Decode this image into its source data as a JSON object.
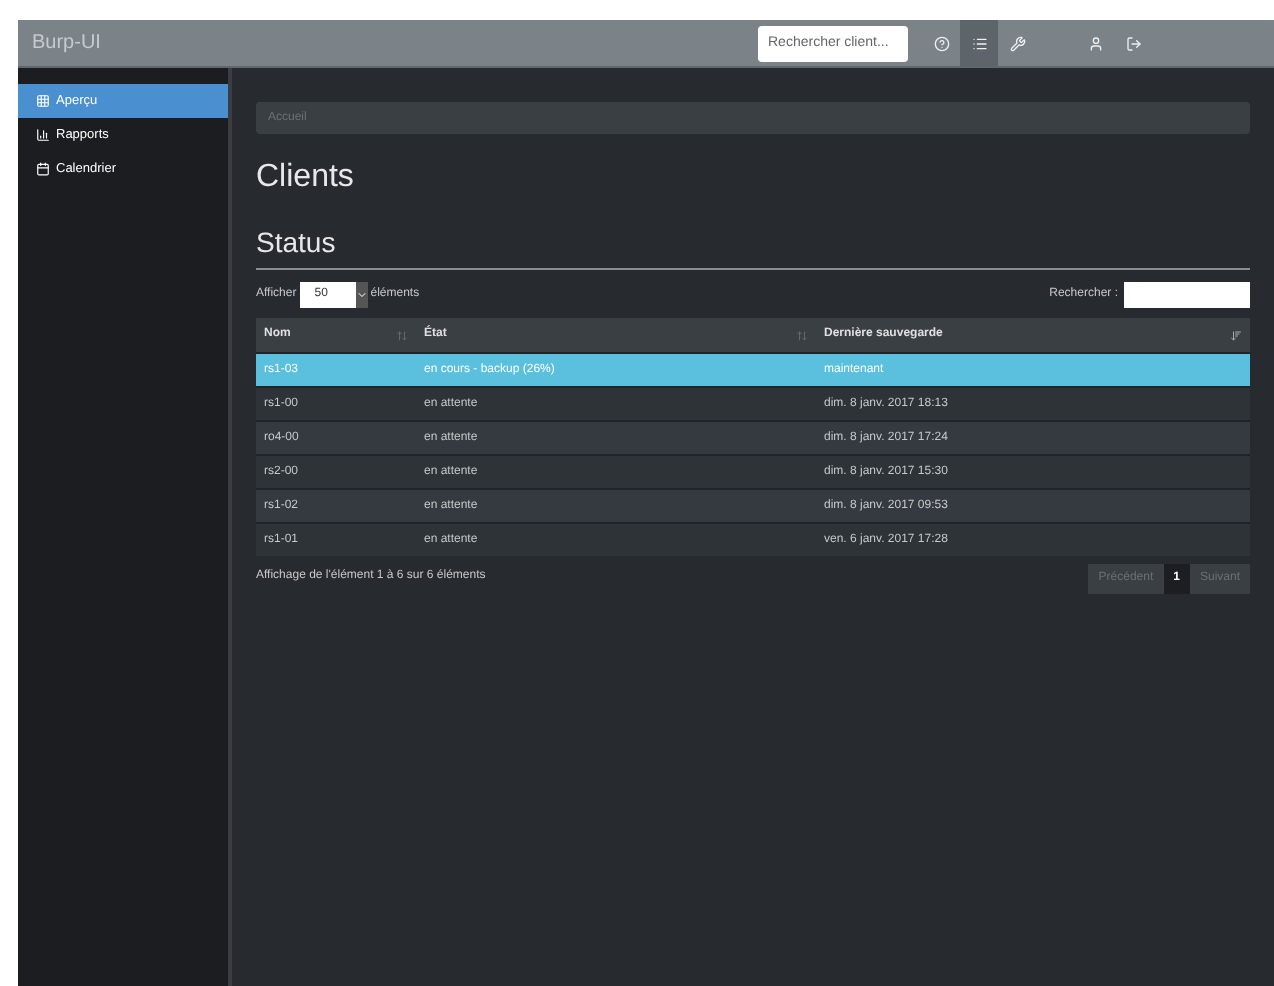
{
  "navbar": {
    "brand": "Burp-UI",
    "search": {
      "placeholder": "Rechercher client..."
    },
    "icons": [
      {
        "kind": "help",
        "selected": false
      },
      {
        "kind": "list",
        "selected": true
      },
      {
        "kind": "wrench",
        "selected": false
      },
      {
        "kind": "user",
        "selected": false
      },
      {
        "kind": "logout",
        "selected": false
      }
    ]
  },
  "sidebar": {
    "items": [
      {
        "label": "Aperçu",
        "selected": true
      },
      {
        "label": "Rapports",
        "selected": false
      },
      {
        "label": "Calendrier",
        "selected": false
      }
    ]
  },
  "breadcrumb": "Accueil",
  "title": "Clients",
  "section": "Status",
  "length": {
    "prefix": "Afficher",
    "value": "50",
    "suffix": "éléments"
  },
  "filter": {
    "label": "Rechercher :"
  },
  "table": {
    "columns": [
      {
        "label": "Nom",
        "sorted": false
      },
      {
        "label": "État",
        "sorted": false
      },
      {
        "label": "Dernière sauvegarde",
        "sorted": true
      }
    ],
    "rows": [
      {
        "cells": [
          "rs1-03",
          "en cours - backup (26%)",
          "maintenant"
        ],
        "selected": true
      },
      {
        "cells": [
          "rs1-00",
          "en attente",
          "dim. 8 janv. 2017 18:13"
        ],
        "selected": false
      },
      {
        "cells": [
          "ro4-00",
          "en attente",
          "dim. 8 janv. 2017 17:24"
        ],
        "selected": false
      },
      {
        "cells": [
          "rs2-00",
          "en attente",
          "dim. 8 janv. 2017 15:30"
        ],
        "selected": false
      },
      {
        "cells": [
          "rs1-02",
          "en attente",
          "dim. 8 janv. 2017 09:53"
        ],
        "selected": false
      },
      {
        "cells": [
          "rs1-01",
          "en attente",
          "ven. 6 janv. 2017 17:28"
        ],
        "selected": false
      }
    ]
  },
  "info": "Affichage de l'élément 1 à 6 sur 6 éléments",
  "pagination": [
    {
      "label": "Précédent",
      "selected": false,
      "disabled": true
    },
    {
      "label": "1",
      "selected": true,
      "disabled": false
    },
    {
      "label": "Suivant",
      "selected": false,
      "disabled": true
    }
  ]
}
